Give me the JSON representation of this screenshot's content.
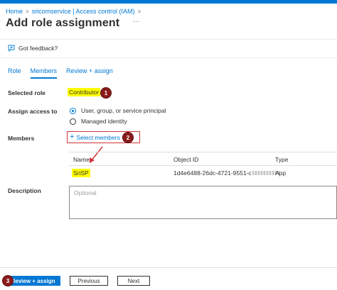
{
  "breadcrumb": {
    "items": [
      "Home",
      "sricomservice | Access control (IAM)"
    ]
  },
  "page": {
    "title": "Add role assignment",
    "more_label": "···"
  },
  "feedback": {
    "label": "Got feedback?"
  },
  "tabs": [
    {
      "label": "Role",
      "active": false
    },
    {
      "label": "Members",
      "active": true
    },
    {
      "label": "Review + assign",
      "active": false
    }
  ],
  "selected_role": {
    "label": "Selected role",
    "value": "Contributor",
    "step": "1"
  },
  "assign_access": {
    "label": "Assign access to",
    "options": [
      {
        "label": "User, group, or service principal",
        "checked": true
      },
      {
        "label": "Managed identity",
        "checked": false
      }
    ]
  },
  "members": {
    "label": "Members",
    "select_label": "Select members",
    "step": "2",
    "columns": [
      "Name",
      "Object ID",
      "Type"
    ],
    "rows": [
      {
        "name": "SriSP",
        "object_id": "1d4e6488-26dc-4721-9551-c",
        "type": "App"
      }
    ]
  },
  "description": {
    "label": "Description",
    "placeholder": "Optional"
  },
  "footer": {
    "step": "3",
    "review_label": "Review + assign",
    "previous_label": "Previous",
    "next_label": "Next"
  },
  "colors": {
    "accent": "#0078d4",
    "highlight": "#ffff00",
    "annotation_badge": "#8b1a1a",
    "annotation_border": "#d13438"
  },
  "icons": [
    "chevron-right-icon",
    "more-icon",
    "feedback-icon",
    "plus-icon",
    "arrow-annotation-icon"
  ]
}
